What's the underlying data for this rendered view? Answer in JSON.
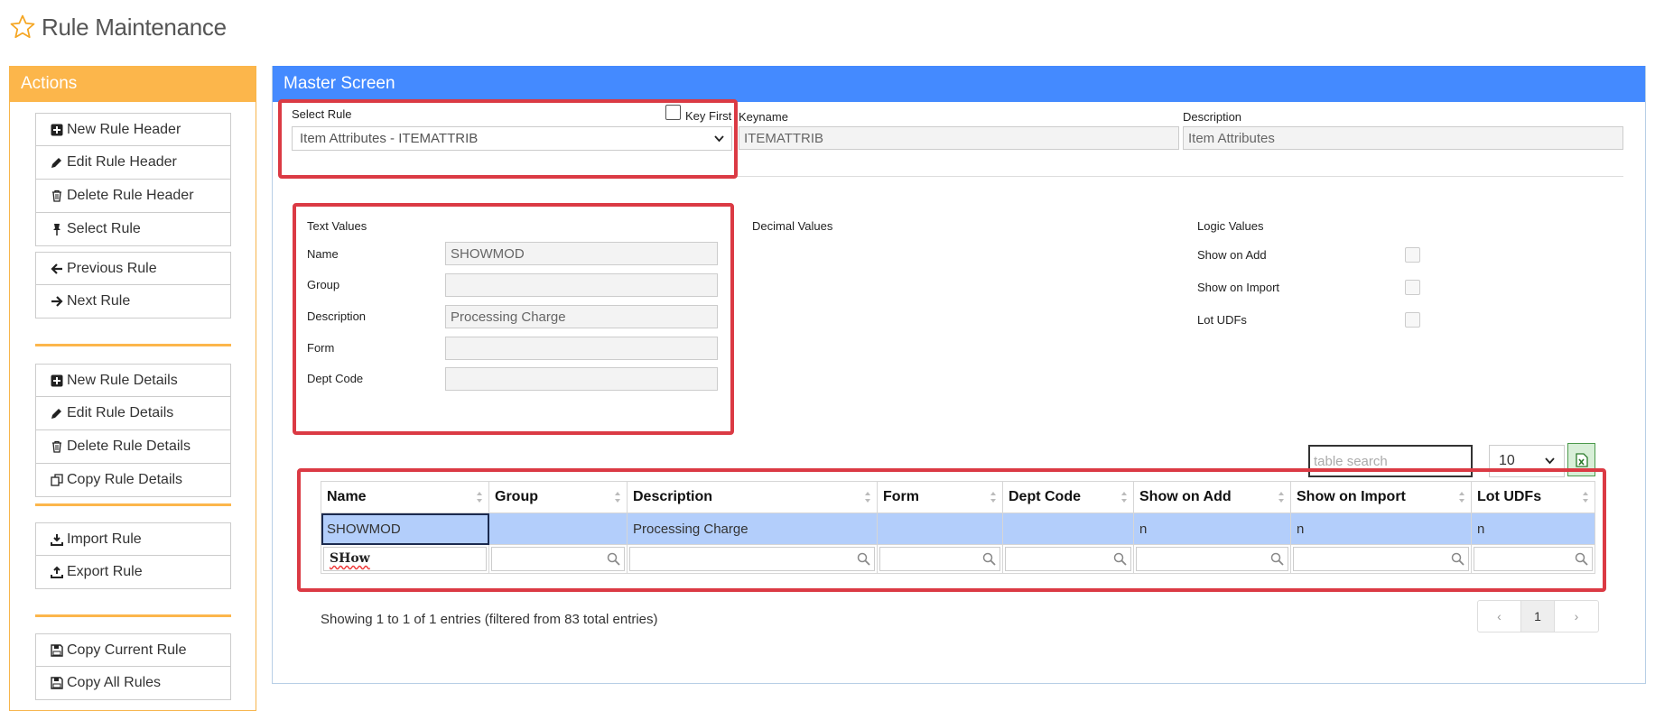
{
  "page": {
    "title": "Rule Maintenance"
  },
  "actions": {
    "title": "Actions",
    "groups": [
      [
        {
          "label": "New Rule Header",
          "icon": "plus-square-icon"
        },
        {
          "label": "Edit Rule Header",
          "icon": "pencil-icon"
        },
        {
          "label": "Delete Rule Header",
          "icon": "trash-icon"
        },
        {
          "label": "Select Rule",
          "icon": "pin-icon"
        }
      ],
      [
        {
          "label": "Previous Rule",
          "icon": "arrow-left-icon"
        },
        {
          "label": "Next Rule",
          "icon": "arrow-right-icon"
        }
      ],
      [
        {
          "label": "New Rule Details",
          "icon": "plus-square-icon"
        },
        {
          "label": "Edit Rule Details",
          "icon": "pencil-icon"
        },
        {
          "label": "Delete Rule Details",
          "icon": "trash-icon"
        },
        {
          "label": "Copy Rule Details",
          "icon": "copy-icon"
        }
      ],
      [
        {
          "label": "Import Rule",
          "icon": "download-icon"
        },
        {
          "label": "Export Rule",
          "icon": "upload-icon"
        }
      ],
      [
        {
          "label": "Copy Current Rule",
          "icon": "save-icon"
        },
        {
          "label": "Copy All Rules",
          "icon": "save-icon"
        }
      ]
    ]
  },
  "master": {
    "title": "Master Screen",
    "select_rule_label": "Select Rule",
    "select_rule_value": "Item Attributes - ITEMATTRIB",
    "key_first_label": "Key First",
    "keyname_label": "Keyname",
    "keyname_value": "ITEMATTRIB",
    "description_label": "Description",
    "description_value": "Item Attributes"
  },
  "text_values": {
    "title": "Text Values",
    "fields": [
      {
        "label": "Name",
        "value": "SHOWMOD"
      },
      {
        "label": "Group",
        "value": ""
      },
      {
        "label": "Description",
        "value": "Processing Charge"
      },
      {
        "label": "Form",
        "value": ""
      },
      {
        "label": "Dept Code",
        "value": ""
      }
    ]
  },
  "decimal_values": {
    "title": "Decimal Values"
  },
  "logic_values": {
    "title": "Logic Values",
    "fields": [
      {
        "label": "Show on Add",
        "checked": false
      },
      {
        "label": "Show on Import",
        "checked": false
      },
      {
        "label": "Lot UDFs",
        "checked": false
      }
    ]
  },
  "table": {
    "search_placeholder": "table search",
    "page_length": "10",
    "columns": [
      "Name",
      "Group",
      "Description",
      "Form",
      "Dept Code",
      "Show on Add",
      "Show on Import",
      "Lot UDFs"
    ],
    "rows": [
      [
        "SHOWMOD",
        "",
        "Processing Charge",
        "",
        "",
        "n",
        "n",
        "n"
      ]
    ],
    "filters": [
      "SHow",
      "",
      "",
      "",
      "",
      "",
      "",
      ""
    ],
    "info": "Showing 1 to 1 of 1 entries (filtered from 83 total entries)",
    "pagination": {
      "prev": "‹",
      "current": "1",
      "next": "›"
    }
  },
  "colors": {
    "actions_header": "#fcb64b",
    "master_header": "#448aff",
    "highlight": "#db3a44",
    "selected_row": "#b3cefb"
  }
}
